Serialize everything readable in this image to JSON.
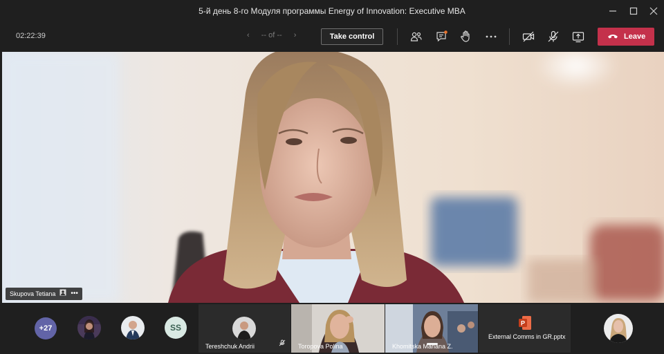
{
  "window": {
    "title": "5-й день 8-го Модуля программы Energy of Innovation: Executive MBA",
    "controls": [
      "minimize-icon",
      "maximize-icon",
      "close-icon"
    ]
  },
  "toolbar": {
    "timer": "02:22:39",
    "pager_text": "-- of --",
    "take_control_label": "Take control",
    "leave_label": "Leave",
    "icons": [
      "participants-icon",
      "chat-icon",
      "raise-hand-icon",
      "more-options-icon",
      "camera-off-icon",
      "mic-off-icon",
      "share-screen-icon",
      "phone-hangup-icon"
    ],
    "colors": {
      "leave": "#c4314b",
      "chat_badge": "#e8722c",
      "accent": "#6264a7"
    }
  },
  "stage": {
    "speaker_name": "Skupova Tetiana"
  },
  "strip": {
    "more_participants": "+27",
    "initials": "SS",
    "tiles": [
      {
        "name": "Tereshchuk Andrii"
      },
      {
        "name": "Toropova Polina"
      },
      {
        "name": "Khomitska Mariana Z."
      },
      {
        "name": "External Comms in GR.pptx"
      }
    ]
  }
}
